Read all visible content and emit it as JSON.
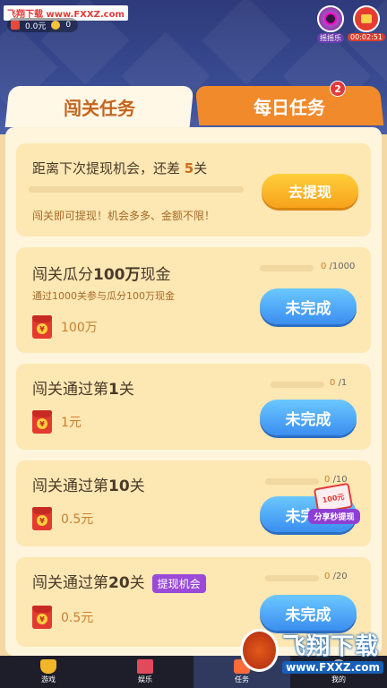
{
  "watermark_top": "飞翔下载 www.FXXZ.com",
  "status": {
    "cash": "0.0元",
    "coins": "0"
  },
  "top_right": {
    "shake_label": "摇摇乐",
    "timer_label": "00:02:51"
  },
  "tabs": [
    {
      "label": "闯关任务",
      "active": true
    },
    {
      "label": "每日任务",
      "active": false,
      "badge": "2"
    }
  ],
  "withdraw_card": {
    "prefix": "距离下次提现机会，还差 ",
    "number": "5",
    "suffix": "关",
    "progress": 0,
    "note": "闯关即可提现！机会多多、金额不限！",
    "button": "去提现"
  },
  "tasks": [
    {
      "title_pre": "闯关瓜分",
      "title_num": "100万",
      "title_post": "现金",
      "subtitle": "通过1000关参与瓜分100万现金",
      "progress_cur": "0",
      "progress_total": "/1000",
      "progress": 0,
      "reward": "100万",
      "button": "未完成"
    },
    {
      "title_pre": "闯关通过第",
      "title_num": "1",
      "title_post": "关",
      "progress_cur": "0",
      "progress_total": "/1",
      "progress": 0,
      "reward": "1元",
      "button": "未完成"
    },
    {
      "title_pre": "闯关通过第",
      "title_num": "10",
      "title_post": "关",
      "progress_cur": "0",
      "progress_total": "/10",
      "progress": 0,
      "reward": "0.5元",
      "button": "未完成"
    },
    {
      "title_pre": "闯关通过第",
      "title_num": "20",
      "title_post": "关",
      "tag": "提现机会",
      "progress_cur": "0",
      "progress_total": "/20",
      "progress": 0,
      "reward": "0.5元",
      "button": "未完成"
    }
  ],
  "float_share": {
    "envelope": "100元",
    "label": "分享秒提现"
  },
  "bottom_nav": [
    {
      "label": "游戏",
      "icon": "trophy-icon"
    },
    {
      "label": "娱乐",
      "icon": "gift-icon"
    },
    {
      "label": "任务",
      "icon": "task-icon",
      "active": true
    },
    {
      "label": "我的",
      "icon": "profile-icon"
    }
  ],
  "watermark_bottom": {
    "big": "飞翔下载",
    "small": "www.FXXZ.com"
  },
  "colors": {
    "accent_orange": "#f08a2b",
    "button_blue": "#3b8ef0",
    "highlight": "#d26a14"
  }
}
